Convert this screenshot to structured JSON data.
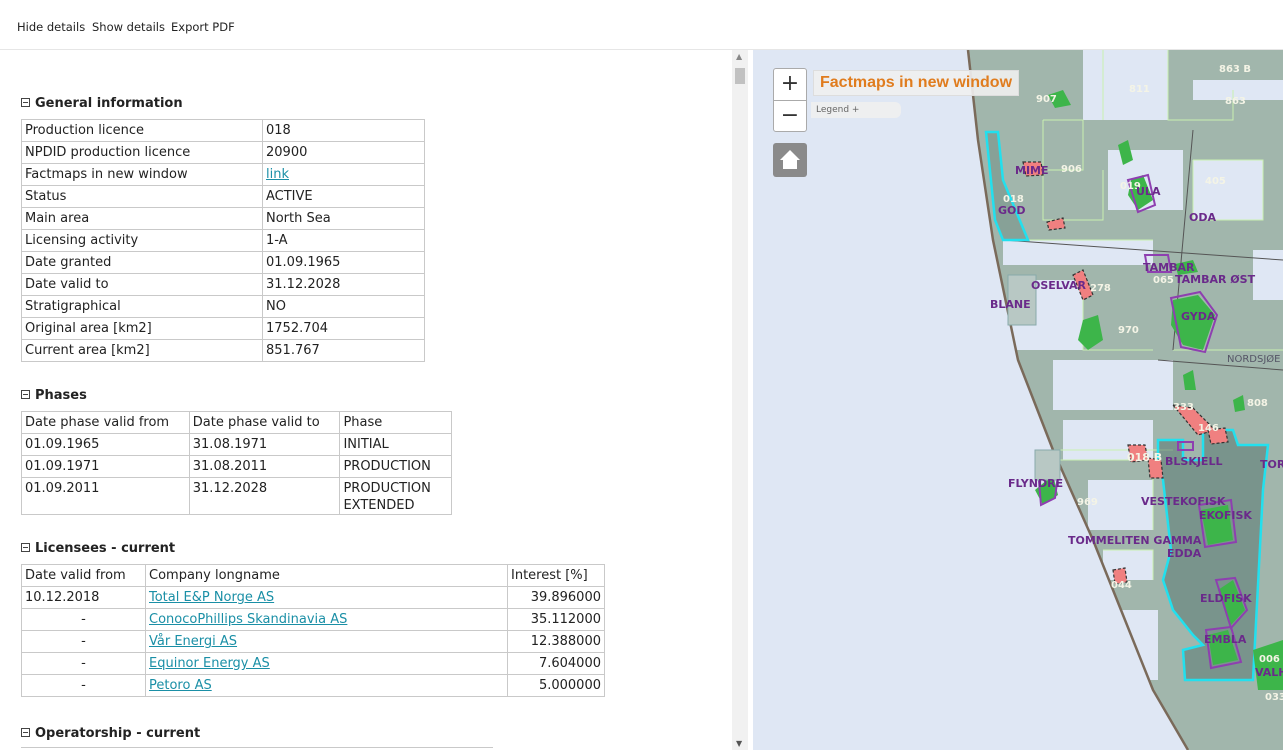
{
  "toolbar": {
    "hide_details": "Hide details",
    "show_details": "Show details",
    "export_pdf": "Export PDF"
  },
  "general": {
    "title": "General information",
    "rows": [
      {
        "label": "Production licence",
        "value": "018"
      },
      {
        "label": "NPDID production licence",
        "value": "20900"
      },
      {
        "label": "Factmaps in new window",
        "value": "link"
      },
      {
        "label": "Status",
        "value": "ACTIVE"
      },
      {
        "label": "Main area",
        "value": "North Sea"
      },
      {
        "label": "Licensing activity",
        "value": "1-A"
      },
      {
        "label": "Date granted",
        "value": "01.09.1965"
      },
      {
        "label": "Date valid to",
        "value": "31.12.2028"
      },
      {
        "label": "Stratigraphical",
        "value": "NO"
      },
      {
        "label": "Original area [km2]",
        "value": "1752.704"
      },
      {
        "label": "Current area [km2]",
        "value": "851.767"
      }
    ]
  },
  "phases": {
    "title": "Phases",
    "headers": [
      "Date phase valid from",
      "Date phase valid to",
      "Phase"
    ],
    "rows": [
      [
        "01.09.1965",
        "31.08.1971",
        "INITIAL"
      ],
      [
        "01.09.1971",
        "31.08.2011",
        "PRODUCTION"
      ],
      [
        "01.09.2011",
        "31.12.2028",
        "PRODUCTION EXTENDED"
      ]
    ]
  },
  "licensees": {
    "title": "Licensees - current",
    "headers": [
      "Date valid from",
      "Company longname",
      "Interest [%]"
    ],
    "rows": [
      [
        "10.12.2018",
        "Total E&P Norge AS",
        "39.896000"
      ],
      [
        "-",
        "ConocoPhillips Skandinavia AS",
        "35.112000"
      ],
      [
        "-",
        "Vår Energi AS",
        "12.388000"
      ],
      [
        "-",
        "Equinor Energy AS",
        "7.604000"
      ],
      [
        "-",
        "Petoro AS",
        "5.000000"
      ]
    ]
  },
  "operatorship": {
    "title": "Operatorship - current"
  },
  "map": {
    "factmaps_title": "Factmaps in new window",
    "legend_label": "Legend +",
    "zoom_in": "+",
    "zoom_out": "−",
    "labels": [
      "907",
      "811",
      "863 B",
      "863",
      "906",
      "019",
      "ULA",
      "405",
      "MIME",
      "018",
      "GOD",
      "ODA",
      "TAMBAR",
      "065",
      "TAMBAR ØST",
      "OSELVAR",
      "278",
      "BLANE",
      "970",
      "GYDA",
      "NORDSJØE",
      "333",
      "146",
      "808",
      "018 B",
      "BLSKJELL",
      "TOR",
      "VESTEKOFISK",
      "EKOFISK",
      "969",
      "FLYNDRE",
      "TOMMELITEN GAMMA",
      "EDDA",
      "044",
      "ELDFISK",
      "EMBLA",
      "006",
      "VALHA",
      "033"
    ],
    "colors": {
      "sea": "#dfe7f4",
      "block": "#98b0a4",
      "field": "#3db54a",
      "licence_outline": "#22e0ee",
      "field_outline": "#8e3fb0",
      "label": "#6a2a8a"
    }
  }
}
